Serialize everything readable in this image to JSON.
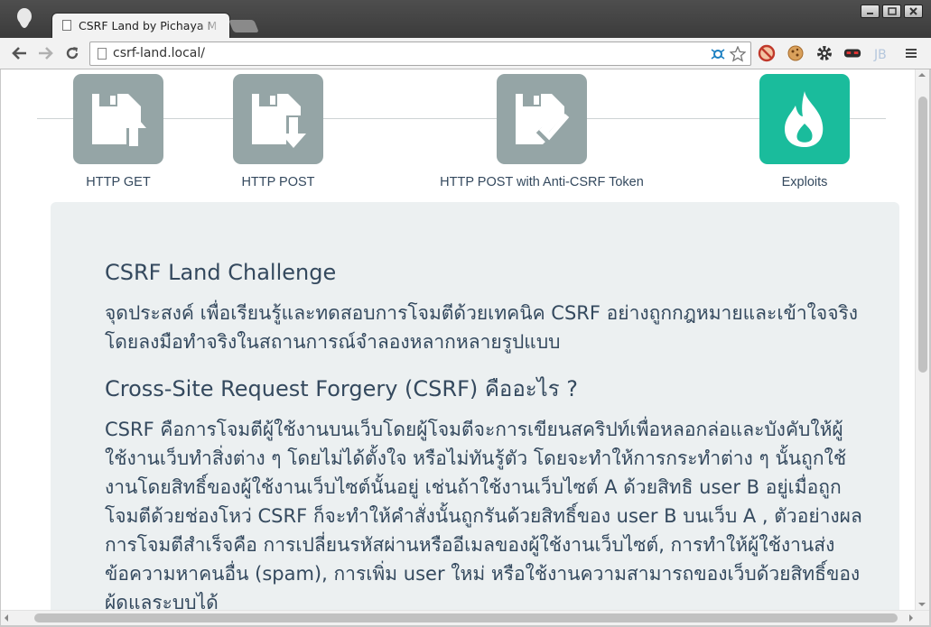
{
  "browser": {
    "tab_title": "CSRF Land by Pichaya M",
    "url": "csrf-land.local/",
    "colors": {
      "titlebar": "#3b3b3b",
      "toolbar": "#f2f2f2"
    }
  },
  "nav": {
    "items": [
      {
        "label": "HTTP GET",
        "icon": "floppy-upload-icon"
      },
      {
        "label": "HTTP POST",
        "icon": "floppy-download-icon"
      },
      {
        "label": "HTTP POST with Anti-CSRF Token",
        "icon": "floppy-check-icon"
      },
      {
        "label": "Exploits",
        "icon": "fire-icon"
      }
    ],
    "colors": {
      "tile": "#95a5a6",
      "tile_active": "#1abc9c",
      "label": "#34495e"
    }
  },
  "content": {
    "heading1": "CSRF Land Challenge",
    "para1": "จุดประสงค์ เพื่อเรียนรู้และทดสอบการโจมตีด้วยเทคนิค CSRF อย่างถูกกฎหมายและเข้าใจจริงโดยลงมือทำจริงในสถานการณ์จำลองหลากหลายรูปแบบ",
    "heading2": "Cross-Site Request Forgery (CSRF) คืออะไร ?",
    "para2": "CSRF คือการโจมตีผู้ใช้งานบนเว็บโดยผู้โจมตีจะการเขียนสคริปท์เพื่อหลอกล่อและบังคับให้ผู้ใช้งานเว็บทำสิ่งต่าง ๆ โดยไม่ได้ตั้งใจ หรือไม่ทันรู้ตัว โดยจะทำให้การกระทำต่าง ๆ นั้นถูกใช้งานโดยสิทธิ์ของผู้ใช้งานเว็บไซต์นั้นอยู่ เช่นถ้าใช้งานเว็บไซต์ A ด้วยสิทธิ user B อยู่เมื่อถูกโจมตีด้วยช่องโหว่ CSRF ก็จะทำให้คำสั่งนั้นถูกรันด้วยสิทธิ์ของ user B บนเว็บ A , ตัวอย่างผลการโจมตีสำเร็จคือ การเปลี่ยนรหัสผ่านหรืออีเมลของผู้ใช้งานเว็บไซต์, การทำให้ผู้ใช้งานส่งข้อความหาคนอื่น (spam), การเพิ่ม user ใหม่ หรือใช้งานความสามารถของเว็บด้วยสิทธิ์ของผู้ดูแลระบบได้",
    "colors": {
      "panel": "#ecf0f1",
      "text": "#34495e"
    }
  }
}
